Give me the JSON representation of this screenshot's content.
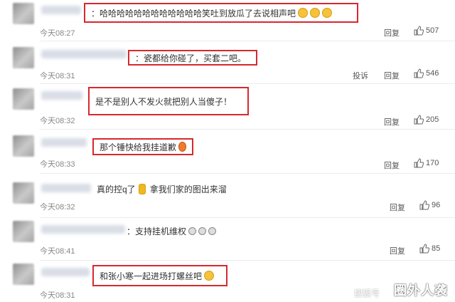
{
  "comments": [
    {
      "text": "：哈哈哈哈哈哈哈哈哈哈哈哈笑吐到放瓜了去说相声吧",
      "emojis": 3,
      "time": "今天08:27",
      "reply": "回复",
      "report": "",
      "likes": "507"
    },
    {
      "text": "：瓷都给你碰了，买套二吧。",
      "emojis": 0,
      "time": "今天08:31",
      "reply": "回复",
      "report": "投诉",
      "likes": "546"
    },
    {
      "text": "是不是别人不发火就把别人当傻子！",
      "emojis": 0,
      "time": "今天08:32",
      "reply": "回复",
      "report": "",
      "likes": "205"
    },
    {
      "text": "那个锤快给我挂道歉",
      "emojis": 1,
      "time": "今天08:33",
      "reply": "回复",
      "report": "",
      "likes": "170"
    },
    {
      "text_a": "真的控q了",
      "text_b": "拿我们家的图出来溜",
      "time": "今天08:32",
      "reply": "回复",
      "report": "",
      "likes": "96"
    },
    {
      "text": "：支持挂机维权",
      "emojis": 3,
      "time": "今天08:41",
      "reply": "回复",
      "report": "",
      "likes": "85"
    },
    {
      "text": "和张小寒一起进场打螺丝吧",
      "emojis": 1,
      "time": "今天08:31",
      "reply": "回复",
      "report": "",
      "likes": ""
    }
  ],
  "watermark": {
    "brand": "圈外人袭",
    "left": "搜狐号"
  },
  "colors": {
    "highlight": "#d7282f",
    "emoji": "#f6c23c"
  }
}
